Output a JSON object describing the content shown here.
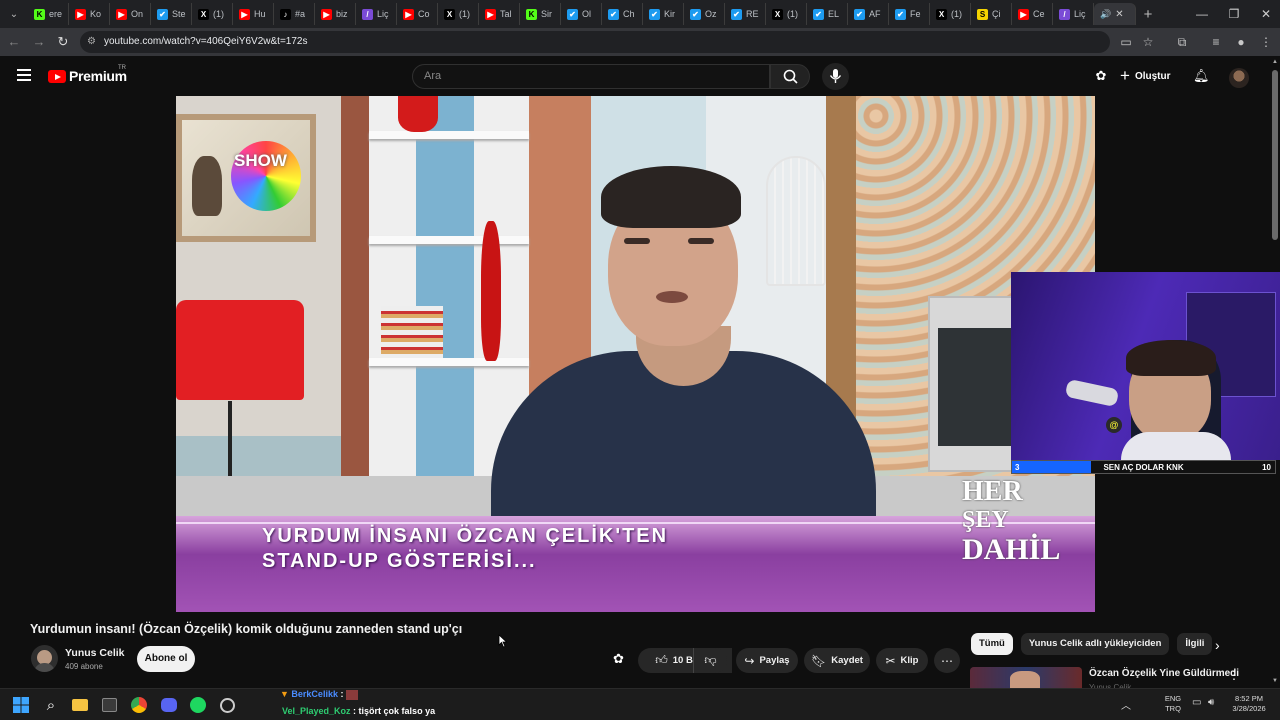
{
  "browser": {
    "tabs": [
      {
        "fav": "K",
        "color": "#53fc18",
        "fg": "#000",
        "label": "ere"
      },
      {
        "fav": "▶",
        "color": "#ff0000",
        "fg": "#fff",
        "label": "Ko"
      },
      {
        "fav": "▶",
        "color": "#ff0000",
        "fg": "#fff",
        "label": "On"
      },
      {
        "fav": "✔",
        "color": "#1d9bf0",
        "fg": "#fff",
        "label": "Ste"
      },
      {
        "fav": "X",
        "color": "#000",
        "fg": "#fff",
        "label": "(1)"
      },
      {
        "fav": "▶",
        "color": "#ff0000",
        "fg": "#fff",
        "label": "Hu"
      },
      {
        "fav": "♪",
        "color": "#000",
        "fg": "#fff",
        "label": "#a"
      },
      {
        "fav": "▶",
        "color": "#ff0000",
        "fg": "#fff",
        "label": "biz"
      },
      {
        "fav": "/",
        "color": "#7a4bd6",
        "fg": "#fff",
        "label": "Liç"
      },
      {
        "fav": "▶",
        "color": "#ff0000",
        "fg": "#fff",
        "label": "Co"
      },
      {
        "fav": "X",
        "color": "#000",
        "fg": "#fff",
        "label": "(1)"
      },
      {
        "fav": "▶",
        "color": "#ff0000",
        "fg": "#fff",
        "label": "Tal"
      },
      {
        "fav": "K",
        "color": "#53fc18",
        "fg": "#000",
        "label": "Sir"
      },
      {
        "fav": "✔",
        "color": "#1d9bf0",
        "fg": "#fff",
        "label": "Ol"
      },
      {
        "fav": "✔",
        "color": "#1d9bf0",
        "fg": "#fff",
        "label": "Ch"
      },
      {
        "fav": "✔",
        "color": "#1d9bf0",
        "fg": "#fff",
        "label": "Kir"
      },
      {
        "fav": "✔",
        "color": "#1d9bf0",
        "fg": "#fff",
        "label": "Oz"
      },
      {
        "fav": "✔",
        "color": "#1d9bf0",
        "fg": "#fff",
        "label": "RE"
      },
      {
        "fav": "X",
        "color": "#000",
        "fg": "#fff",
        "label": "(1)"
      },
      {
        "fav": "✔",
        "color": "#1d9bf0",
        "fg": "#fff",
        "label": "EL"
      },
      {
        "fav": "✔",
        "color": "#1d9bf0",
        "fg": "#fff",
        "label": "AF"
      },
      {
        "fav": "✔",
        "color": "#1d9bf0",
        "fg": "#fff",
        "label": "Fe"
      },
      {
        "fav": "X",
        "color": "#000",
        "fg": "#fff",
        "label": "(1)"
      },
      {
        "fav": "S",
        "color": "#f5d400",
        "fg": "#000",
        "label": "Çi"
      },
      {
        "fav": "▶",
        "color": "#ff0000",
        "fg": "#fff",
        "label": "Ce"
      },
      {
        "fav": "/",
        "color": "#7a4bd6",
        "fg": "#fff",
        "label": "Liç"
      }
    ],
    "url": "youtube.com/watch?v=406QeiY6V2w&t=172s"
  },
  "youtube": {
    "brand": "Premium",
    "region": "TR",
    "search_placeholder": "Ara",
    "create_label": "Oluştur"
  },
  "video": {
    "overlay_logo": "SHOW",
    "lower_third_line1": "YURDUM İNSANI ÖZCAN ÇELİK'TEN",
    "lower_third_line2": "STAND-UP GÖSTERİSİ...",
    "corner_logo_line1": "HER",
    "corner_logo_line2": "ŞEY",
    "corner_logo_line3": "DAHİL"
  },
  "webcam": {
    "bar_left_value": "3",
    "bar_text": "SEN AÇ DOLAR KNK",
    "bar_right_value": "10",
    "bar_progress": 0.3
  },
  "watch": {
    "title": "Yurdumun insanı! (Özcan Özçelik) komik olduğunu zanneden stand up'çı",
    "channel_name": "Yunus Celik",
    "subscribers": "409 abone",
    "subscribe_label": "Abone ol",
    "likes": "10 B",
    "share_label": "Paylaş",
    "save_label": "Kaydet",
    "clip_label": "Klip"
  },
  "sidebar": {
    "chips": [
      "Tümü",
      "Yunus Celik adlı yükleyiciden",
      "İlgili"
    ],
    "rec_title": "Özcan Özçelik Yine Güldürmedi",
    "rec_channel": "Yunus Celik"
  },
  "chat": [
    {
      "user": "BerkCelikk",
      "color": "#4a8cff",
      "message": ""
    },
    {
      "user": "Vel_Played_Koz",
      "color": "#2ecc71",
      "message": "tişört çok falso ya"
    }
  ],
  "tray": {
    "lang1": "ENG",
    "lang2": "TRQ",
    "time": "8:52 PM",
    "date": "3/28/2026"
  }
}
